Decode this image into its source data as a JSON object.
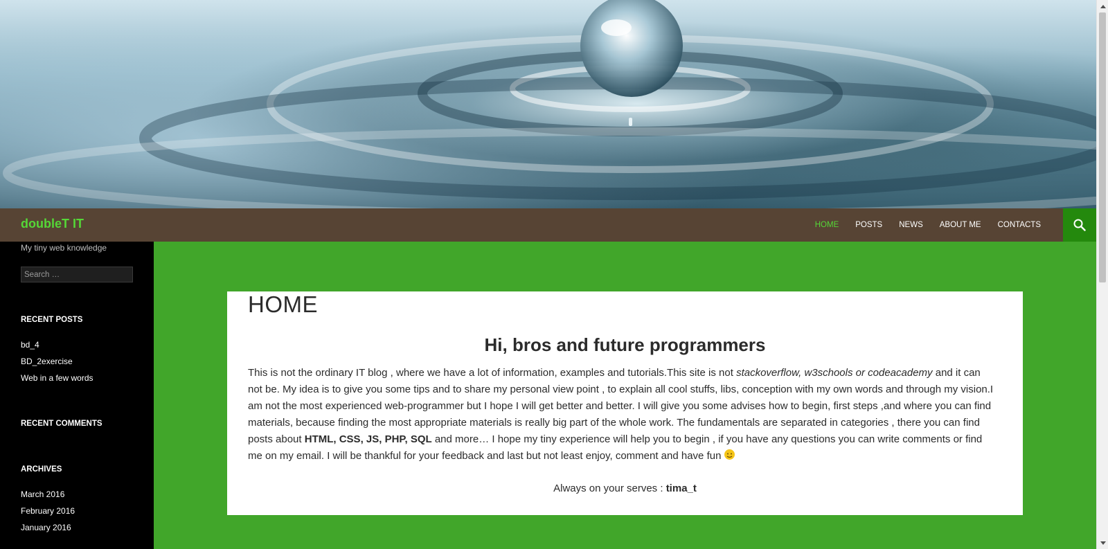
{
  "header": {
    "site_title": "doubleT IT",
    "tagline": "My tiny web knowledge",
    "banner_icon": "water-drop-image"
  },
  "nav": {
    "items": [
      {
        "label": "HOME",
        "active": true
      },
      {
        "label": "POSTS",
        "active": false
      },
      {
        "label": "NEWS",
        "active": false
      },
      {
        "label": "ABOUT ME",
        "active": false
      },
      {
        "label": "CONTACTS",
        "active": false
      }
    ],
    "search_icon": "search-icon"
  },
  "sidebar": {
    "search_placeholder": "Search …",
    "recent_posts": {
      "title": "RECENT POSTS",
      "items": [
        "bd_4",
        "BD_2exercise",
        "Web in a few words"
      ]
    },
    "recent_comments": {
      "title": "RECENT COMMENTS"
    },
    "archives": {
      "title": "ARCHIVES",
      "items": [
        "March 2016",
        "February 2016",
        "January 2016"
      ]
    }
  },
  "page": {
    "title": "HOME",
    "heading": "Hi, bros and future programmers",
    "body": {
      "p1": "This is not the ordinary IT blog , where we have a lot of information, examples and tutorials.This site is  not ",
      "italic": "stackoverflow, w3schools or codeacademy",
      "p2": " and it can not be. My idea is to give you  some tips and to share my personal view point , to explain all cool stuffs, libs, conception with my own  words and through my vision.I am not the most experienced  web-programmer but I hope I will get better and better. I will give you some advises how to begin, first steps ,and where you can find materials, because finding the most appropriate materials is really big part of the whole work. The fundamentals are  separated  in categories , there you can find posts about ",
      "bold": "HTML, CSS, JS,  PHP, SQL",
      "p3": " and more…  I hope  my tiny experience will help you to begin , if you have any questions you can write comments or find me on my email. I will be thankful for your feedback and last but not least  enjoy, comment and have fun "
    },
    "signoff_text": "Always on your serves : ",
    "signoff_name": "tima_t"
  },
  "colors": {
    "accent_green": "#55d737",
    "page_background": "#41a62a",
    "navbar": "#574434",
    "search_button": "#24890d"
  }
}
